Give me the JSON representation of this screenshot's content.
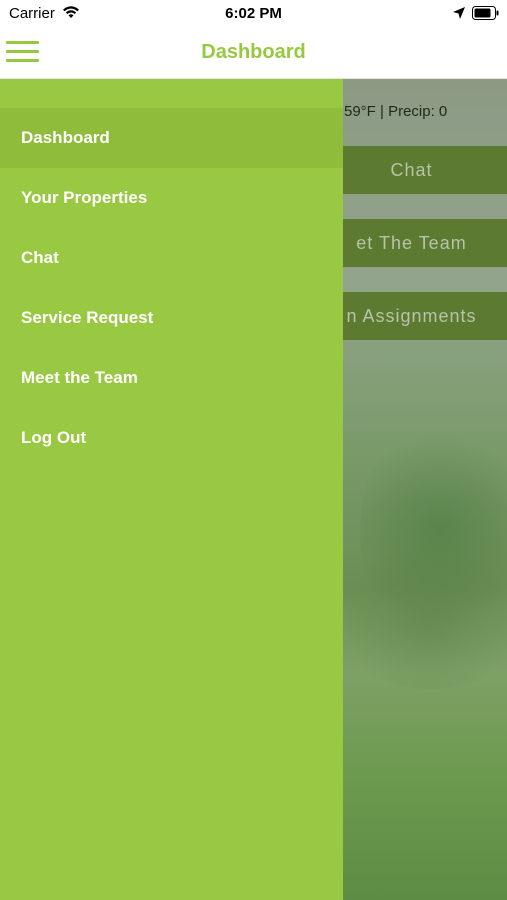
{
  "status_bar": {
    "carrier": "Carrier",
    "time": "6:02 PM"
  },
  "nav": {
    "title": "Dashboard"
  },
  "background": {
    "weather": "59°F | Precip: 0",
    "buttons": [
      "Chat",
      "et The Team",
      "n Assignments"
    ]
  },
  "menu": {
    "items": [
      {
        "label": "Dashboard",
        "active": true
      },
      {
        "label": "Your Properties"
      },
      {
        "label": "Chat"
      },
      {
        "label": "Service Request"
      },
      {
        "label": "Meet the Team"
      },
      {
        "label": "Log Out"
      }
    ]
  },
  "colors": {
    "brand_green": "#97c93f",
    "menu_background": "#99c842",
    "menu_active": "#8fbd3b"
  },
  "icons": {
    "menu": "hamburger-icon",
    "wifi": "wifi-icon",
    "location": "location-arrow-icon",
    "battery": "battery-icon"
  }
}
